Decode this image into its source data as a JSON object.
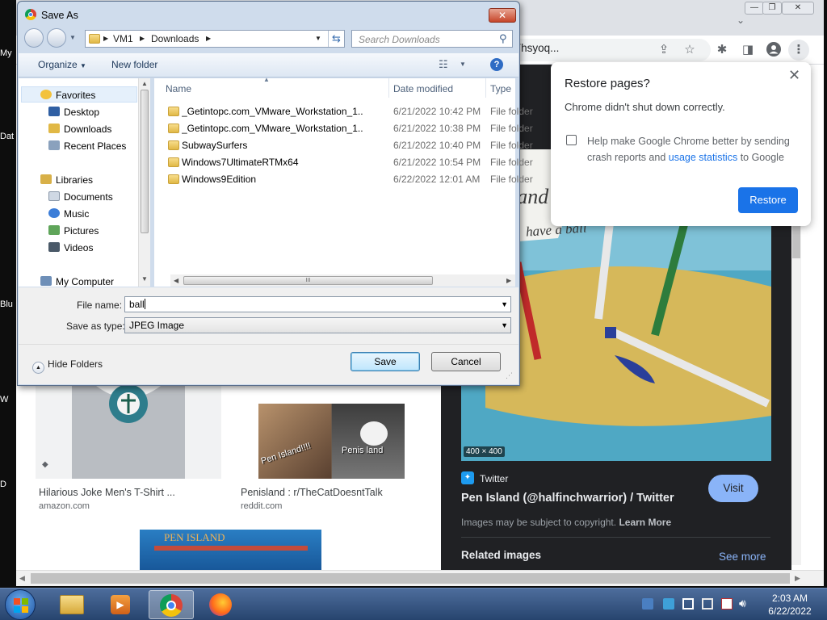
{
  "desktop": {
    "labels": [
      "My",
      "Dat",
      "Blu",
      "W",
      "D"
    ]
  },
  "dialog": {
    "title": "Save As",
    "close_glyph": "✕",
    "breadcrumb": [
      "VM1",
      "Downloads"
    ],
    "search_placeholder": "Search Downloads",
    "toolbar": {
      "organize": "Organize",
      "new_folder": "New folder"
    },
    "nav": {
      "favorites": "Favorites",
      "desktop": "Desktop",
      "downloads": "Downloads",
      "recent": "Recent Places",
      "libraries": "Libraries",
      "documents": "Documents",
      "music": "Music",
      "pictures": "Pictures",
      "videos": "Videos",
      "computer": "My Computer"
    },
    "columns": {
      "name": "Name",
      "date": "Date modified",
      "type": "Type"
    },
    "files": [
      {
        "name": "_Getintopc.com_VMware_Workstation_1...",
        "date": "6/21/2022 10:42 PM",
        "type": "File folder"
      },
      {
        "name": "_Getintopc.com_VMware_Workstation_1...",
        "date": "6/21/2022 10:38 PM",
        "type": "File folder"
      },
      {
        "name": "SubwaySurfers",
        "date": "6/21/2022 10:40 PM",
        "type": "File folder"
      },
      {
        "name": "Windows7UltimateRTMx64",
        "date": "6/21/2022 10:54 PM",
        "type": "File folder"
      },
      {
        "name": "Windows9Edition",
        "date": "6/22/2022 12:01 AM",
        "type": "File folder"
      }
    ],
    "hscroll_grip": "III",
    "file_name_label": "File name:",
    "file_name_value": "ball",
    "save_type_label": "Save as type:",
    "save_type_value": "JPEG Image",
    "hide_folders": "Hide Folders",
    "save": "Save",
    "cancel": "Cancel"
  },
  "browser": {
    "url_fragment": "1&fir=RIsmtU1Yhsyoq...",
    "window_controls": [
      "—",
      "❐",
      "✕"
    ],
    "results": [
      {
        "title": "Hilarious Joke Men's T-Shirt ...",
        "source": "amazon.com"
      },
      {
        "title": "Penisland : r/TheCatDoesntTalk",
        "source": "reddit.com"
      }
    ],
    "meme_caption_left": "Pen Island!!!!",
    "meme_caption_right": "Penis land",
    "banner_text": "PEN ISLAND",
    "side_panel": {
      "image_dims": "400 × 400",
      "image_text_top": "land",
      "image_text_bottom": "have a ball",
      "site": "Twitter",
      "title": "Pen Island (@halfinchwarrior) / Twitter",
      "visit": "Visit",
      "copyright": "Images may be subject to copyright.",
      "learn_more": "Learn More",
      "related": "Related images",
      "see_more": "See more"
    }
  },
  "restore_bubble": {
    "title": "Restore pages?",
    "message": "Chrome didn't shut down correctly.",
    "checkbox_text_before": "Help make Google Chrome better by sending crash reports and ",
    "checkbox_link": "usage statistics",
    "checkbox_text_after": " to Google",
    "button": "Restore",
    "close_glyph": "✕"
  },
  "taskbar": {
    "time": "2:03 AM",
    "date": "6/22/2022"
  }
}
